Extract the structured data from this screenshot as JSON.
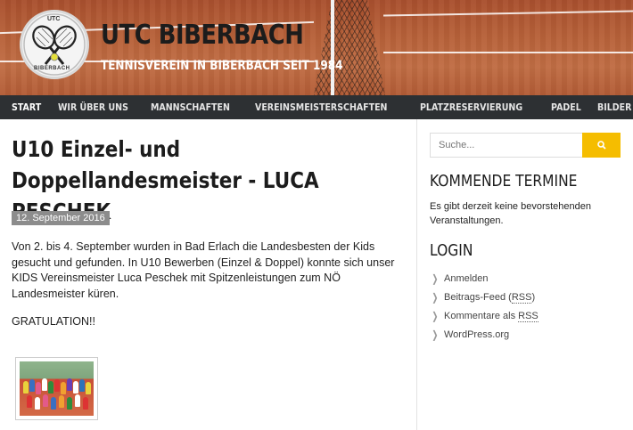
{
  "header": {
    "title": "UTC BIBERBACH",
    "tagline": "TENNISVEREIN IN BIBERBACH SEIT 1984",
    "logo_text_top": "UTC",
    "logo_text_bottom": "BIBERBACH"
  },
  "nav": {
    "items": [
      {
        "label": "START",
        "active": true
      },
      {
        "label": "WIR ÜBER UNS"
      },
      {
        "label": "MANNSCHAFTEN"
      },
      {
        "label": "VEREINSMEISTERSCHAFTEN"
      },
      {
        "label": "PLATZRESERVIERUNG"
      },
      {
        "label": "PADEL"
      },
      {
        "label": "BILDER"
      }
    ]
  },
  "post": {
    "title": "U10 Einzel- und Doppellandesmeister - LUCA PESCHEK",
    "date": "12. September 2016",
    "paragraph1": "Von 2. bis 4. September wurden in Bad Erlach die Landesbesten der Kids gesucht und gefunden. In U10 Bewerben (Einzel & Doppel) konnte sich unser KIDS Vereinsmeister Luca Peschek mit Spitzenleistungen zum NÖ Landesmeister küren.",
    "paragraph2": "GRATULATION!!"
  },
  "sidebar": {
    "search_placeholder": "Suche...",
    "termine_title": "KOMMENDE TERMINE",
    "termine_text": "Es gibt derzeit keine bevorstehenden Veranstaltungen.",
    "login_title": "LOGIN",
    "login_links": {
      "anmelden": "Anmelden",
      "feed_prefix": "Beitrags-Feed (",
      "feed_rss": "RSS",
      "feed_suffix": ")",
      "comments_prefix": "Kommentare als ",
      "comments_rss": "RSS",
      "wordpress": "WordPress.org"
    }
  },
  "colors": {
    "accent": "#f5bd00",
    "nav_bg": "#2d3033",
    "date_badge": "#8c8c8c"
  },
  "icons": {
    "search": "search-icon",
    "chevron": "chevron-right-icon"
  }
}
